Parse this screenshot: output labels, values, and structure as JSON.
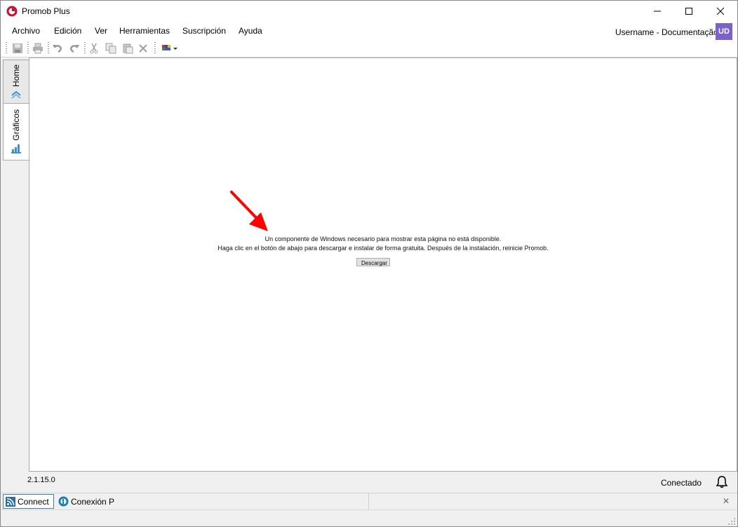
{
  "window": {
    "title": "Promob Plus"
  },
  "menu": {
    "items": [
      "Archivo",
      "Edición",
      "Ver",
      "Herramientas",
      "Suscripción",
      "Ayuda"
    ],
    "user": "Username - Documentação",
    "avatar": "UD"
  },
  "toolbar": {
    "icons": [
      "save-icon",
      "print-icon",
      "undo-icon",
      "redo-icon",
      "cut-icon",
      "copy-icon",
      "paste-icon",
      "delete-icon",
      "color-palette-icon"
    ]
  },
  "sidebar": {
    "tabs": [
      {
        "label": "Home",
        "icon": "home-icon"
      },
      {
        "label": "Gráficos",
        "icon": "chart-icon"
      }
    ]
  },
  "content": {
    "message_line1": "Un componente de Windows necesario para mostrar esta página no está disponible.",
    "message_line2": "Haga clic en el botón de abajo para descargar e instalar de forma gratuita. Después de la instalación, reinicie Promob.",
    "download_button": "Descargar"
  },
  "status": {
    "version": "2.1.15.0",
    "connection": "Conectado"
  },
  "bottom": {
    "connect_tab": "Connect",
    "conexion_tab": "Conexión P"
  },
  "colors": {
    "accent": "#3c7fb1",
    "avatar": "#7b61c9",
    "arrow": "#ff0000"
  }
}
